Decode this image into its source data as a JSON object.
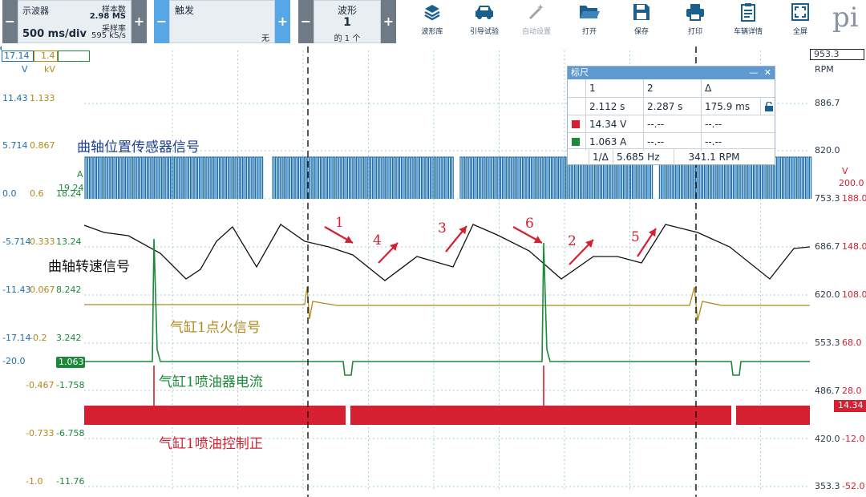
{
  "toolbar": {
    "scope_label": "示波器",
    "timebase": "500 ms/div",
    "samples_label": "样本数",
    "samples_value": "2.98 MS",
    "rate_label": "采样率",
    "rate_value": "595 kS/s",
    "trigger_label": "触发",
    "trigger_value": "无",
    "waveform_label": "波形",
    "waveform_number": "1",
    "waveform_of": "的 1 个",
    "minus": "−",
    "plus": "+",
    "buttons": [
      {
        "label": "波形库",
        "icon": "waveform-library-icon",
        "enabled": true
      },
      {
        "label": "引导试验",
        "icon": "car-icon",
        "enabled": true
      },
      {
        "label": "自动设置",
        "icon": "magic-wand-icon",
        "enabled": false
      },
      {
        "label": "打开",
        "icon": "folder-open-icon",
        "enabled": true
      },
      {
        "label": "保存",
        "icon": "save-icon",
        "enabled": true
      },
      {
        "label": "打印",
        "icon": "print-icon",
        "enabled": true
      },
      {
        "label": "车辆详情",
        "icon": "clipboard-icon",
        "enabled": true
      },
      {
        "label": "全屏",
        "icon": "fullscreen-icon",
        "enabled": true
      }
    ],
    "logo_text": "pi"
  },
  "scales": {
    "chA_top": "17.14",
    "chB_top": "1.4",
    "chA_unit": "V",
    "chB_unit": "kV",
    "rpm_top": "953.3",
    "rpm_unit": "RPM",
    "left_rows": [
      {
        "a": "11.43",
        "b": "1.133"
      },
      {
        "a": "5.714",
        "b": "0.867"
      },
      {
        "a": "0.0",
        "b": "0.6",
        "c": "18.24"
      },
      {
        "a": "-5.714",
        "b": "0.333",
        "c": "13.24"
      },
      {
        "a": "-11.43",
        "b": "0.067",
        "c": "8.242"
      },
      {
        "a": "-17.14",
        "b": "-0.2",
        "c": "3.242"
      },
      {
        "a": "-20.0",
        "b": "",
        "c": ""
      },
      {
        "a": "",
        "b": "-0.467",
        "c": "-1.758"
      },
      {
        "a": "",
        "b": "-0.733",
        "c": "-6.758"
      },
      {
        "a": "",
        "b": "-1.0",
        "c": "-11.76"
      }
    ],
    "c_unit": "A",
    "c_top": "19.24",
    "green_marker": "1.063",
    "right_rpm": [
      "886.7",
      "820.0",
      "753.3",
      "686.7",
      "620.0",
      "553.3",
      "486.7",
      "420.0",
      "353.3"
    ],
    "right_v": [
      "188.0",
      "148.0",
      "108.0",
      "68.0",
      "28.0",
      "-12.0",
      "-52.0"
    ],
    "v_unit": "V",
    "v_top": "200.0",
    "red_marker": "14.34"
  },
  "ruler": {
    "title": "标尺",
    "minimize": "—",
    "close": "✕",
    "col1": "1",
    "col2": "2",
    "col3": "Δ",
    "t1": "2.112 s",
    "t2": "2.287 s",
    "tdelta": "175.9 ms",
    "red_v1": "14.34 V",
    "red_v2": "--.--",
    "red_vd": "--.--",
    "green_v1": "1.063 A",
    "green_v2": "--.--",
    "green_vd": "--.--",
    "inv_label": "1/Δ",
    "freq": "5.685 Hz",
    "rpm": "341.1 RPM"
  },
  "annotations": {
    "crank_position": "曲轴位置传感器信号",
    "crank_speed": "曲轴转速信号",
    "ignition": "气缸1点火信号",
    "injector_current": "气缸1喷油器电流",
    "injector_control": "气缸1喷油控制正",
    "numbers": [
      "1",
      "4",
      "3",
      "6",
      "2",
      "5"
    ]
  },
  "colors": {
    "blue": "#1b6fb0",
    "gold": "#b0891a",
    "green": "#1a8a3a",
    "red": "#d42030",
    "black": "#111111",
    "grid": "#9fd4cf"
  }
}
